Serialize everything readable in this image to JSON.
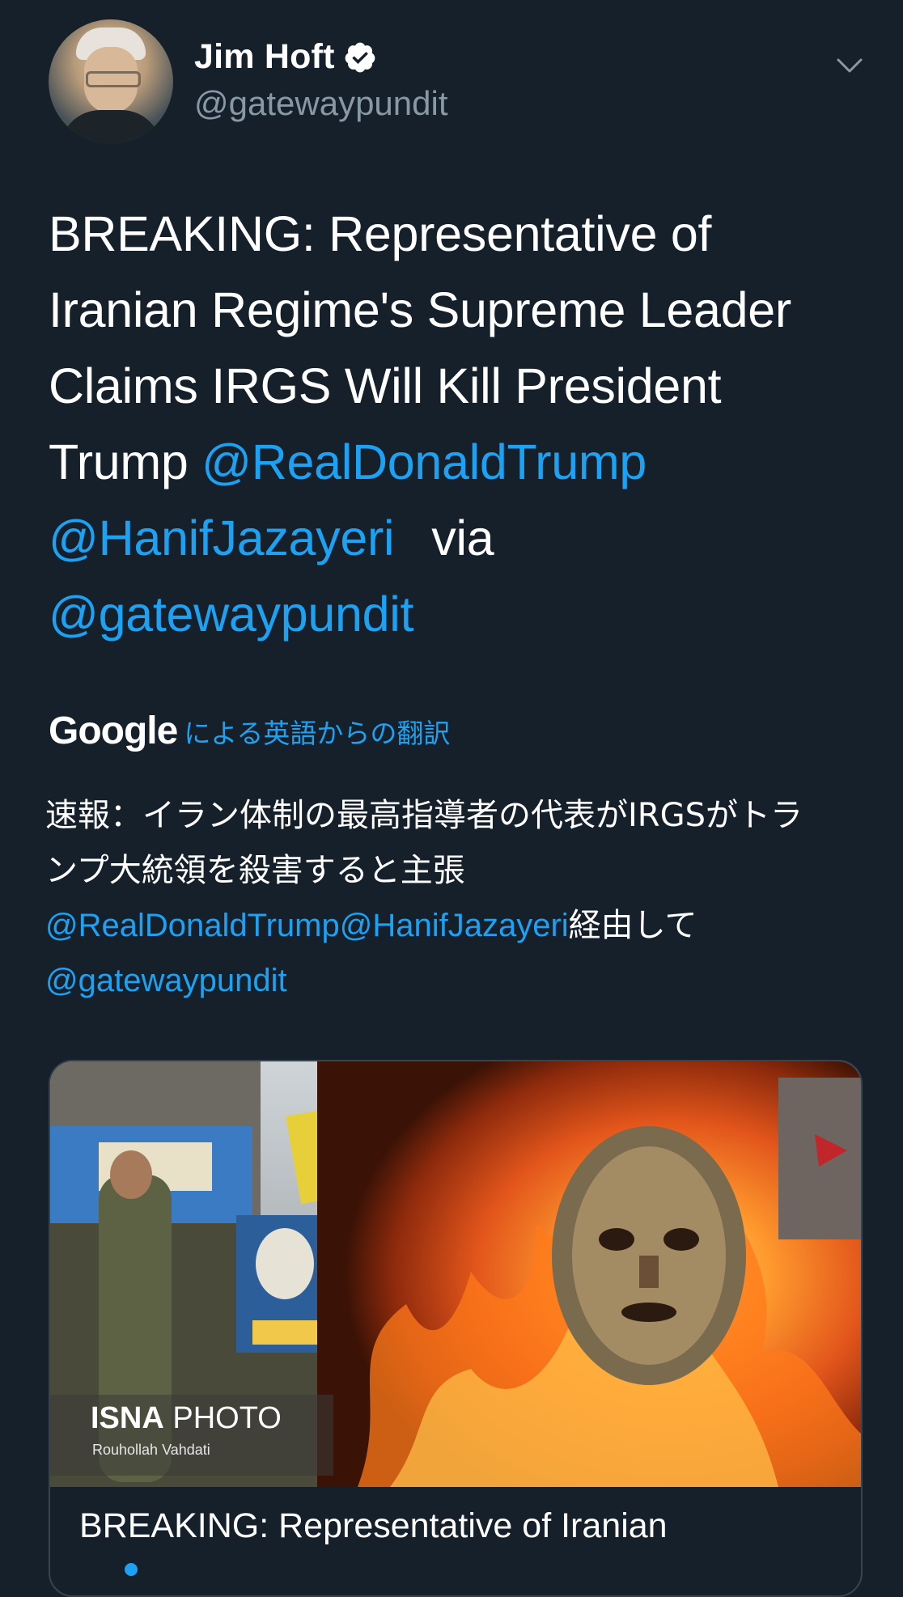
{
  "author": {
    "display_name": "Jim Hoft",
    "handle": "@gatewaypundit",
    "verified_icon": "verified-badge-icon",
    "menu_icon": "chevron-down-icon"
  },
  "tweet": {
    "line1": "BREAKING: Representative of",
    "line2": "Iranian Regime's Supreme Leader",
    "line3": "Claims IRGS Will Kill President",
    "line4_prefix": "Trump ",
    "mention1": "@RealDonaldTrump",
    "mention2": "@HanifJazayeri",
    "via": "via",
    "mention3": "@gatewaypundit"
  },
  "translation": {
    "provider": "Google",
    "label": "による英語からの翻訳",
    "text_line1": "速報：イラン体制の最高指導者の代表がIRGSがトラ",
    "text_line2": "ンプ大統領を殺害すると主張",
    "mention1": "@RealDonaldTrump",
    "mention2": "@HanifJazayeri",
    "suffix": "経由して",
    "mention3": "@gatewaypundit"
  },
  "card": {
    "watermark_bold": "ISNA",
    "watermark_rest": " PHOTO",
    "watermark_credit": "Rouhollah Vahdati",
    "title": "BREAKING: Representative of Iranian"
  },
  "colors": {
    "background": "#15202b",
    "accent": "#1da1f2",
    "secondary_text": "#8899a6",
    "border": "#38444d"
  }
}
